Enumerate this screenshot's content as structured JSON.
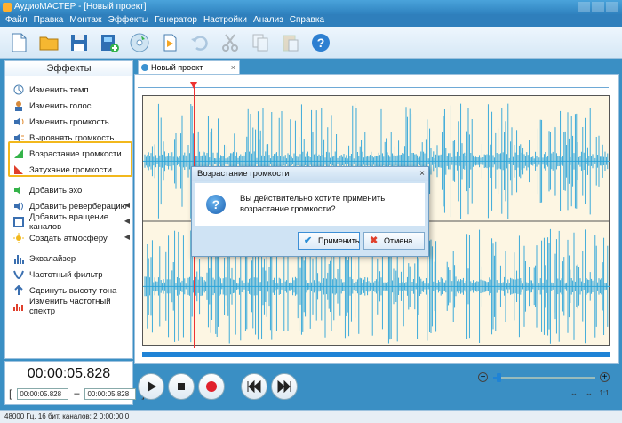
{
  "window": {
    "title": "АудиоМАСТЕР - [Новый проект]"
  },
  "menu": [
    "Файл",
    "Правка",
    "Монтаж",
    "Эффекты",
    "Генератор",
    "Настройки",
    "Анализ",
    "Справка"
  ],
  "toolbar": {
    "buttons": [
      {
        "icon": "new-file-icon"
      },
      {
        "icon": "open-folder-icon"
      },
      {
        "icon": "save-icon"
      },
      {
        "icon": "add-video-icon"
      },
      {
        "icon": "record-cd-icon"
      },
      {
        "icon": "play-file-icon"
      },
      {
        "icon": "undo-icon"
      },
      {
        "icon": "cut-icon"
      },
      {
        "icon": "copy-icon"
      },
      {
        "icon": "paste-icon"
      },
      {
        "icon": "help-icon"
      }
    ]
  },
  "effects_panel": {
    "title": "Эффекты",
    "items": [
      {
        "label": "Изменить темп",
        "icon": "tempo-icon"
      },
      {
        "label": "Изменить голос",
        "icon": "voice-icon"
      },
      {
        "label": "Изменить громкость",
        "icon": "volume-icon"
      },
      {
        "label": "Выровнять громкость",
        "icon": "normalize-icon"
      },
      {
        "label": "Возрастание громкости",
        "icon": "fade-in-icon"
      },
      {
        "label": "Затухание громкости",
        "icon": "fade-out-icon"
      },
      {
        "label": "Добавить эхо",
        "icon": "echo-icon"
      },
      {
        "label": "Добавить реверберацию",
        "icon": "reverb-icon",
        "submenu": true
      },
      {
        "label": "Добавить вращение каналов",
        "icon": "rotate-channels-icon",
        "submenu": true
      },
      {
        "label": "Создать атмосферу",
        "icon": "atmosphere-icon",
        "submenu": true
      },
      {
        "label": "Эквалайзер",
        "icon": "equalizer-icon"
      },
      {
        "label": "Частотный фильтр",
        "icon": "filter-icon"
      },
      {
        "label": "Сдвинуть высоту тона",
        "icon": "pitch-icon"
      },
      {
        "label": "Изменить частотный спектр",
        "icon": "spectrum-icon"
      }
    ]
  },
  "tab": {
    "label": "Новый проект",
    "close": "×"
  },
  "time": {
    "current": "00:00:05.828",
    "selection_start": "00:00:05.828",
    "selection_end": "00:00:05.828"
  },
  "dialog": {
    "title": "Возрастание громкости",
    "close": "×",
    "message": "Вы действительно хотите применить возрастание громкости?",
    "apply_label": "Применить",
    "cancel_label": "Отмена"
  },
  "zoom": {
    "minus": "−",
    "plus": "+",
    "level": 0.05
  },
  "view_buttons": [
    "↔",
    "↔",
    "1:1"
  ],
  "status": "48000 Гц, 16 бит, каналов: 2   0:00:00.0",
  "colors": {
    "accent": "#1f83d6",
    "highlight": "#f2b81c",
    "cursor": "#e33333",
    "wave_bg": "#fdf6e3"
  }
}
